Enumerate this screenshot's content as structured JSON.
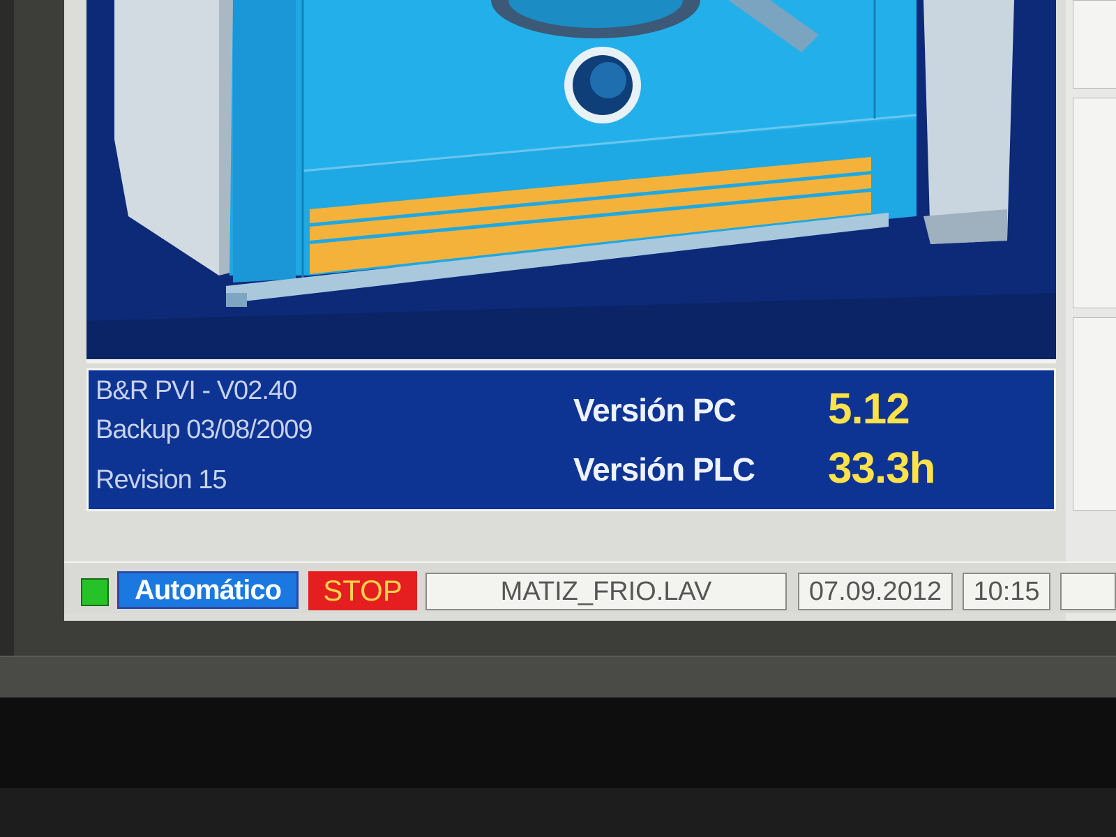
{
  "info": {
    "software": "B&R PVI - V02.40",
    "backup": "Backup 03/08/2009",
    "revision": "Revision 15",
    "pc_label": "Versión PC",
    "pc_value": "5.12",
    "plc_label": "Versión PLC",
    "plc_value": "33.3h"
  },
  "statusbar": {
    "mode": "Automático",
    "stop": "STOP",
    "program": "MATIZ_FRIO.LAV",
    "date": "07.09.2012",
    "time": "10:15",
    "led_color": "#27c227"
  },
  "icons": {
    "machine": "washing-machine-illustration"
  }
}
